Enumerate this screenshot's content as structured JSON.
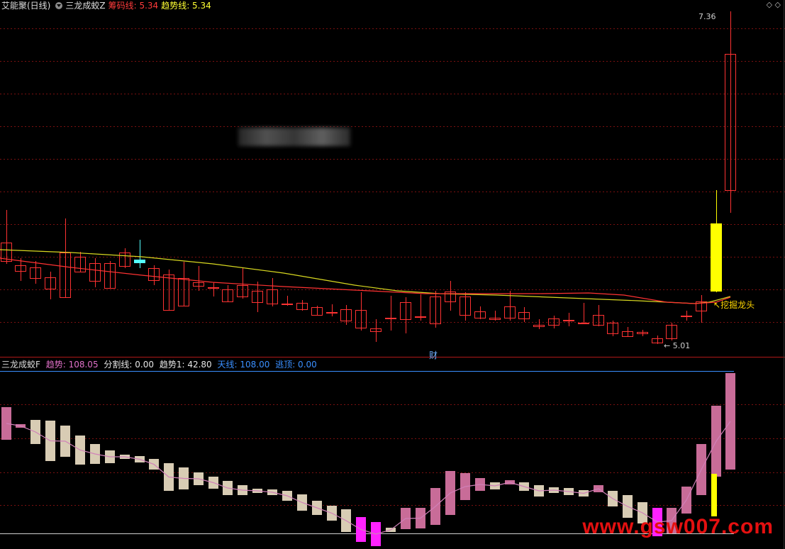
{
  "top_panel": {
    "title": "艾能聚(日线)",
    "indicator_name": "三龙成蛟Z",
    "legend": [
      {
        "label": "筹码线: 5.34",
        "color": "#ff3b3b"
      },
      {
        "label": "趋势线: 5.34",
        "color": "#ffff33"
      }
    ],
    "high_label": "7.36",
    "low_label": "5.01",
    "signal_label": "挖掘龙头",
    "marker_label": "财"
  },
  "bottom_panel": {
    "indicator_name": "三龙成蛟F",
    "legend": [
      {
        "label": "趋势: 108.05",
        "color": "#e070c8"
      },
      {
        "label": "分割线: 0.00",
        "color": "#e6e6e6"
      },
      {
        "label": "趋势1: 42.80",
        "color": "#e6e6e6"
      },
      {
        "label": "天线: 108.00",
        "color": "#3a8fff"
      },
      {
        "label": "逃顶: 0.00",
        "color": "#3a8fff"
      }
    ]
  },
  "colors": {
    "up": "#ff3232",
    "down": "#54ffff",
    "chip_line": "#ff3232",
    "trend_line": "#d8d820",
    "signal_bar": "#ffff00",
    "bar_pink": "#c86c98",
    "bar_beige": "#d8ccb4",
    "bar_magenta": "#ff22ff",
    "grid": "#7a1010",
    "divider": "#b01818",
    "sky_line": "#3a8fff"
  },
  "watermark": "www.gsw007.com",
  "corner_icons": "◇ ◇"
}
